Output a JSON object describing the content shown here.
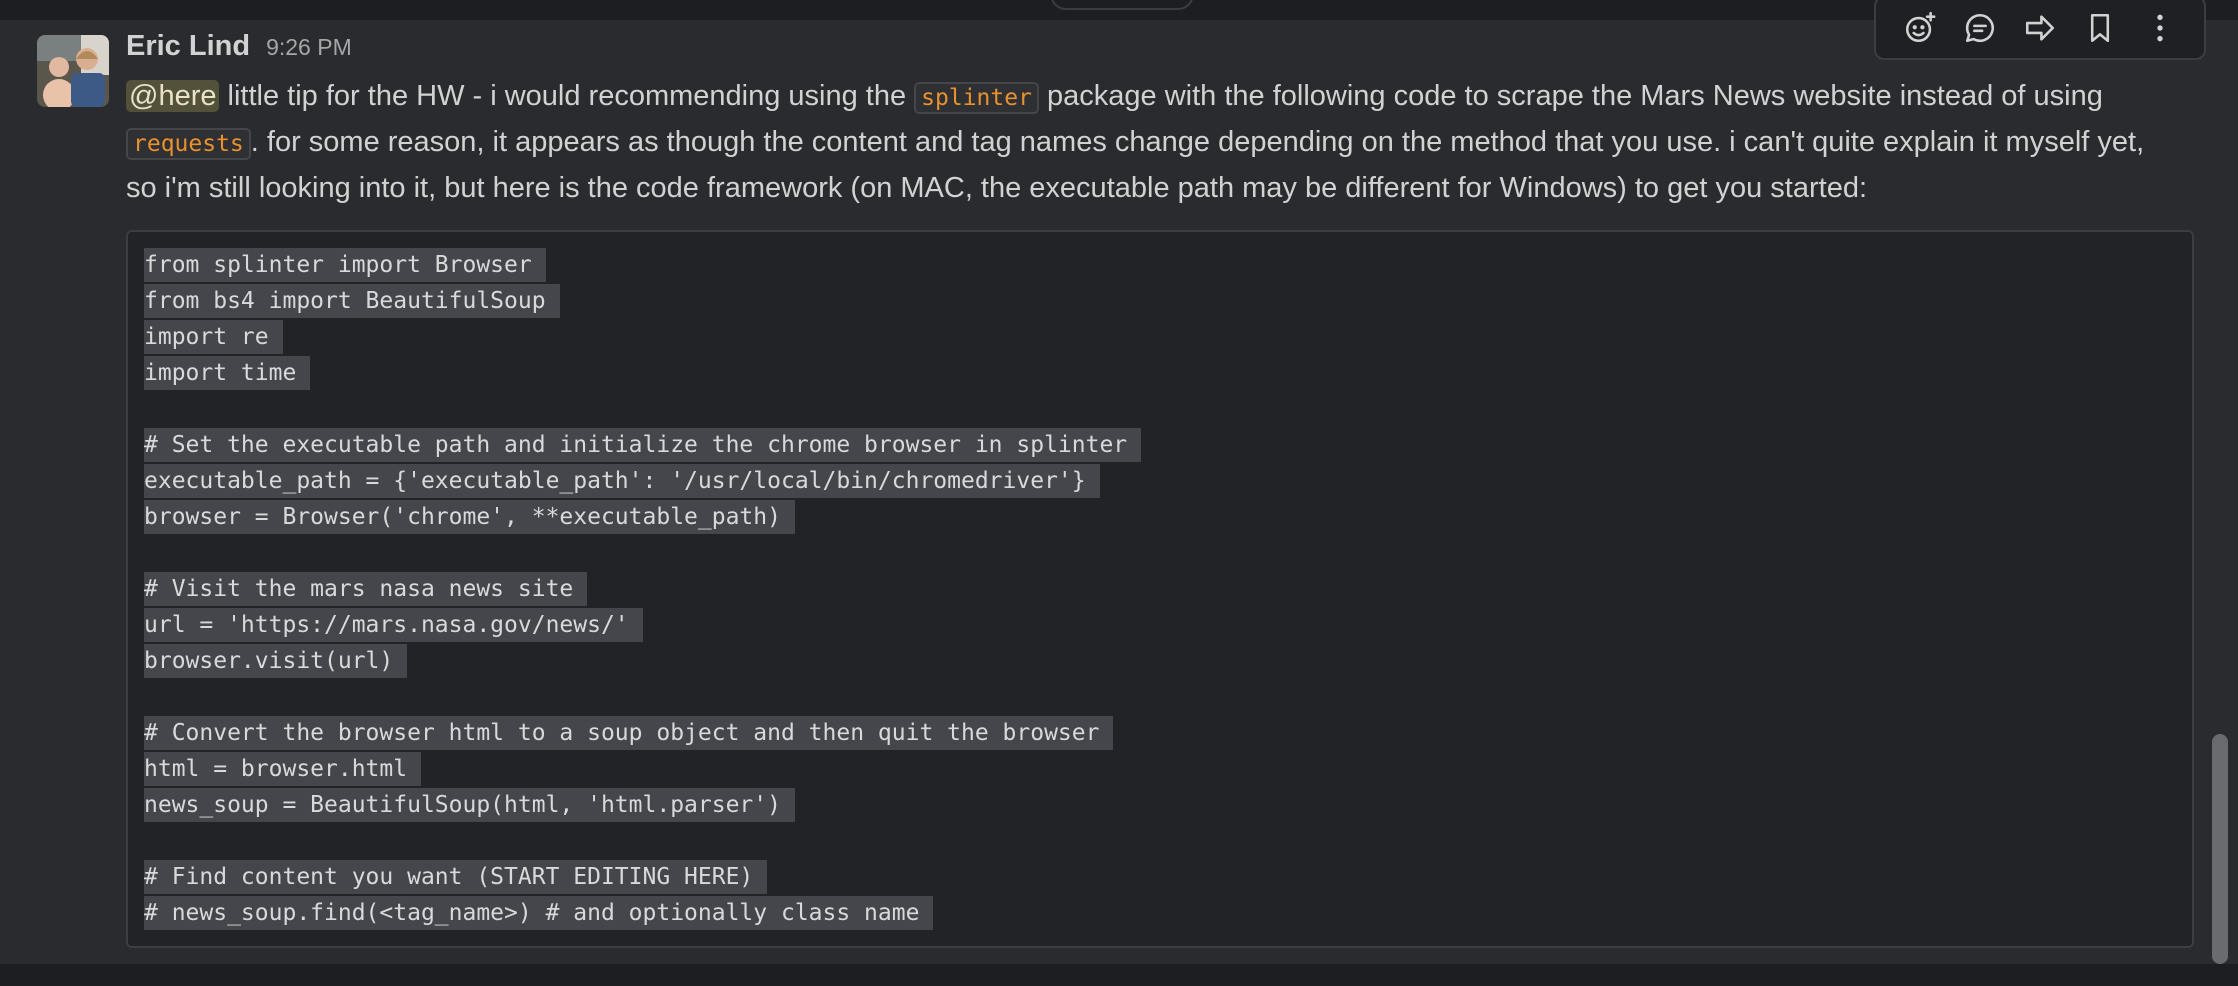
{
  "message": {
    "sender": "Eric Lind",
    "time": "9:26 PM",
    "mention": "@here",
    "text_1": " little tip for the HW - i would recommending using the ",
    "code_splinter": "splinter",
    "text_2": " package with the following code to scrape the Mars News website instead of using",
    "code_requests": "requests",
    "text_3": ". for some reason, it appears as though the content and tag names change depending on the method that you use. i can't quite explain it myself yet,",
    "text_4": "so i'm still looking into it, but here is the code framework (on MAC, the executable path may be different for Windows) to get you started:"
  },
  "code_lines": [
    "from splinter import Browser",
    "from bs4 import BeautifulSoup",
    "import re",
    "import time",
    "",
    "# Set the executable path and initialize the chrome browser in splinter",
    "executable_path = {'executable_path': '/usr/local/bin/chromedriver'}",
    "browser = Browser('chrome', **executable_path)",
    "",
    "# Visit the mars nasa news site",
    "url = 'https://mars.nasa.gov/news/'",
    "browser.visit(url)",
    "",
    "# Convert the browser html to a soup object and then quit the browser",
    "html = browser.html",
    "news_soup = BeautifulSoup(html, 'html.parser')",
    "",
    "# Find content you want (START EDITING HERE)",
    "# news_soup.find(<tag_name>) # and optionally class name"
  ],
  "toolbar_icons": [
    "add-reaction-icon",
    "reply-thread-icon",
    "forward-icon",
    "bookmark-icon",
    "more-actions-icon"
  ],
  "colors": {
    "background": "#2a2b2e",
    "text": "#d1d2d3",
    "mention_bg": "#54513a",
    "inline_code": "#e8912d",
    "code_highlight": "#45464b"
  }
}
